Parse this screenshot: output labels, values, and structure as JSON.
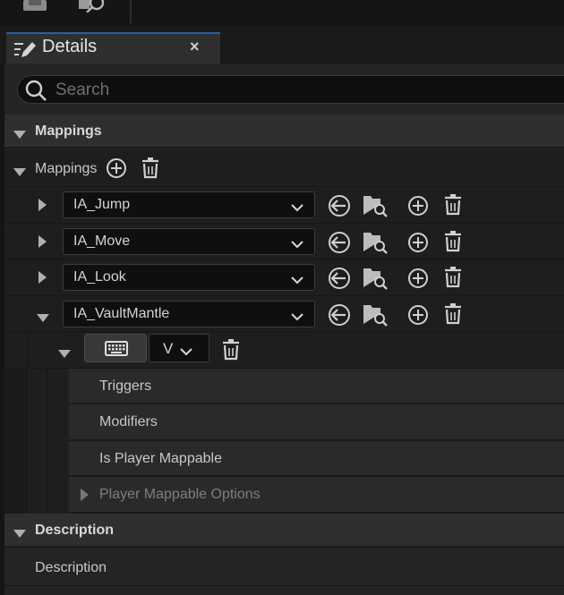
{
  "toolbar": {
    "icons": [
      "save-icon",
      "browse-icon"
    ]
  },
  "tab": {
    "title": "Details",
    "close_label": "×",
    "icon": "details-pencil-icon"
  },
  "search": {
    "placeholder": "Search",
    "value": ""
  },
  "categories": {
    "mappings_header": "Mappings",
    "description_header": "Description"
  },
  "mappings_array": {
    "label": "Mappings",
    "add_icon": "add-circle-icon",
    "delete_icon": "trash-icon"
  },
  "mapping_items": [
    {
      "action": "IA_Jump",
      "expanded": false
    },
    {
      "action": "IA_Move",
      "expanded": false
    },
    {
      "action": "IA_Look",
      "expanded": false
    },
    {
      "action": "IA_VaultMantle",
      "expanded": true
    }
  ],
  "key_binding": {
    "key_icon": "keyboard-icon",
    "key_value": "V"
  },
  "sub_properties": {
    "triggers": "Triggers",
    "modifiers": "Modifiers",
    "is_player_mappable": "Is Player Mappable",
    "player_mappable_options": "Player Mappable Options"
  },
  "description": {
    "label": "Description"
  },
  "colors": {
    "accent": "#2a5ea8",
    "panel_bg": "#242424",
    "row_bg": "#1e1e1e",
    "category_bg": "#2f2f2f"
  }
}
